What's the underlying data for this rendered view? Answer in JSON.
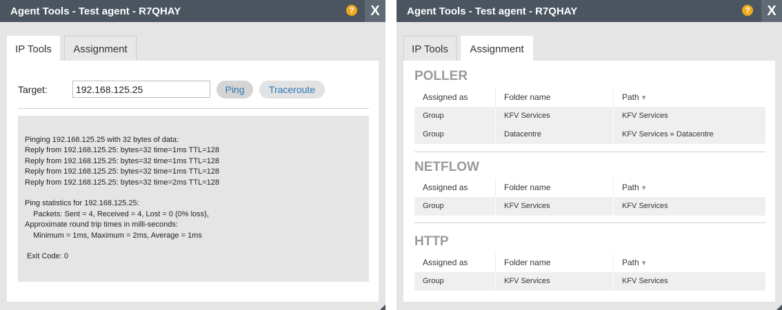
{
  "window": {
    "title": "Agent Tools - Test agent - R7QHAY",
    "help_label": "?",
    "close_label": "X"
  },
  "tabs": {
    "ip_tools": "IP Tools",
    "assignment": "Assignment"
  },
  "ip_tools": {
    "target_label": "Target:",
    "target_value": "192.168.125.25",
    "ping_label": "Ping",
    "traceroute_label": "Traceroute",
    "output_lines": [
      "Pinging 192.168.125.25 with 32 bytes of data:",
      "Reply from 192.168.125.25: bytes=32 time=1ms TTL=128",
      "Reply from 192.168.125.25: bytes=32 time=1ms TTL=128",
      "Reply from 192.168.125.25: bytes=32 time=1ms TTL=128",
      "Reply from 192.168.125.25: bytes=32 time=2ms TTL=128",
      "",
      "Ping statistics for 192.168.125.25:",
      "    Packets: Sent = 4, Received = 4, Lost = 0 (0% loss),",
      "Approximate round trip times in milli-seconds:",
      "    Minimum = 1ms, Maximum = 2ms, Average = 1ms",
      "",
      " Exit Code: 0"
    ]
  },
  "assignment": {
    "columns": {
      "assigned_as": "Assigned as",
      "folder_name": "Folder name",
      "path": "Path"
    },
    "sections": [
      {
        "title": "POLLER",
        "rows": [
          {
            "assigned_as": "Group",
            "folder_name": "KFV Services",
            "path": "KFV Services"
          },
          {
            "assigned_as": "Group",
            "folder_name": "Datacentre",
            "path": "KFV Services » Datacentre"
          }
        ]
      },
      {
        "title": "NETFLOW",
        "rows": [
          {
            "assigned_as": "Group",
            "folder_name": "KFV Services",
            "path": "KFV Services"
          }
        ]
      },
      {
        "title": "HTTP",
        "rows": [
          {
            "assigned_as": "Group",
            "folder_name": "KFV Services",
            "path": "KFV Services"
          }
        ]
      }
    ]
  },
  "colors": {
    "titlebar": "#4a5560",
    "help_icon": "#f0a81c",
    "link_blue": "#2a78b8",
    "section_title": "#9a9a9a"
  }
}
